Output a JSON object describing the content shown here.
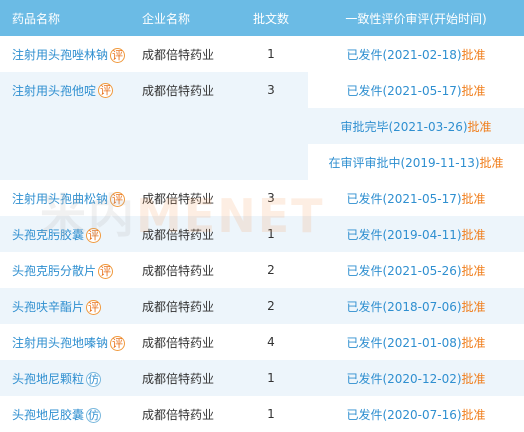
{
  "headers": {
    "drug_name": "药品名称",
    "company": "企业名称",
    "batch_count": "批文数",
    "review": "一致性评价审评(开始时间)"
  },
  "rows": [
    {
      "name": "注射用头孢唑林钠",
      "tag": "评",
      "tag_type": "ping",
      "company": "成都倍特药业",
      "count": "1",
      "statuses": [
        {
          "status": "已发件(2021-02-18)",
          "approve": "批准"
        }
      ]
    },
    {
      "name": "注射用头孢他啶",
      "tag": "评",
      "tag_type": "ping",
      "company": "成都倍特药业",
      "count": "3",
      "statuses": [
        {
          "status": "已发件(2021-05-17)",
          "approve": "批准"
        },
        {
          "status": "审批完毕(2021-03-26)",
          "approve": "批准"
        },
        {
          "status": "在审评审批中(2019-11-13)",
          "approve": "批准"
        }
      ]
    },
    {
      "name": "注射用头孢曲松钠",
      "tag": "评",
      "tag_type": "ping",
      "company": "成都倍特药业",
      "count": "3",
      "statuses": [
        {
          "status": "已发件(2021-05-17)",
          "approve": "批准"
        }
      ]
    },
    {
      "name": "头孢克肟胶囊",
      "tag": "评",
      "tag_type": "ping",
      "company": "成都倍特药业",
      "count": "1",
      "statuses": [
        {
          "status": "已发件(2019-04-11)",
          "approve": "批准"
        }
      ]
    },
    {
      "name": "头孢克肟分散片",
      "tag": "评",
      "tag_type": "ping",
      "company": "成都倍特药业",
      "count": "2",
      "statuses": [
        {
          "status": "已发件(2021-05-26)",
          "approve": "批准"
        }
      ]
    },
    {
      "name": "头孢呋辛酯片",
      "tag": "评",
      "tag_type": "ping",
      "company": "成都倍特药业",
      "count": "2",
      "statuses": [
        {
          "status": "已发件(2018-07-06)",
          "approve": "批准"
        }
      ]
    },
    {
      "name": "注射用头孢地嗪钠",
      "tag": "评",
      "tag_type": "ping",
      "company": "成都倍特药业",
      "count": "4",
      "statuses": [
        {
          "status": "已发件(2021-01-08)",
          "approve": "批准"
        }
      ]
    },
    {
      "name": "头孢地尼颗粒",
      "tag": "仿",
      "tag_type": "fang",
      "company": "成都倍特药业",
      "count": "1",
      "statuses": [
        {
          "status": "已发件(2020-12-02)",
          "approve": "批准"
        }
      ]
    },
    {
      "name": "头孢地尼胶囊",
      "tag": "仿",
      "tag_type": "fang",
      "company": "成都倍特药业",
      "count": "1",
      "statuses": [
        {
          "status": "已发件(2020-07-16)",
          "approve": "批准"
        }
      ]
    }
  ],
  "watermark": {
    "cn": "米内",
    "en": "MENET"
  },
  "colors": {
    "header_bg": "#6bbbe5",
    "link": "#2f8fd0",
    "approve": "#f07d1a",
    "stripe": "#edf5fb"
  }
}
